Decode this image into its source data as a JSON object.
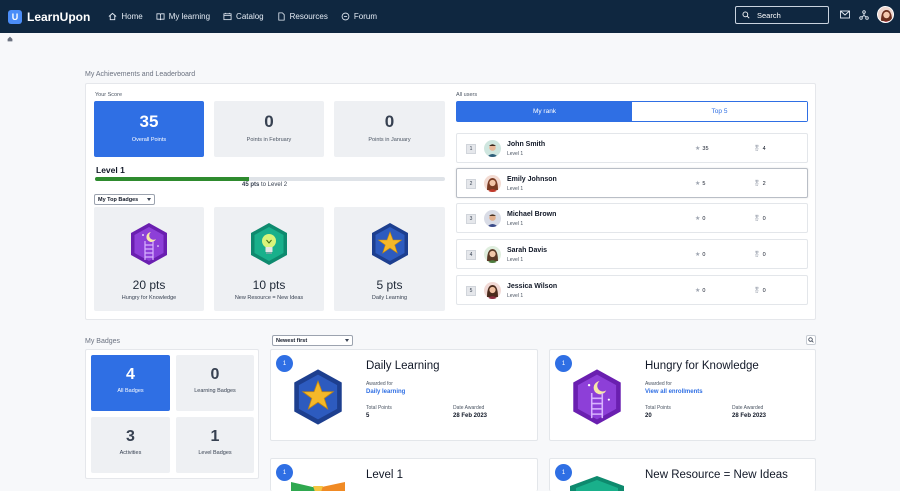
{
  "app": {
    "logo_text": "LearnUpon",
    "logo_letter": "U"
  },
  "nav": {
    "items": [
      {
        "label": "Home",
        "icon": "home-icon"
      },
      {
        "label": "My learning",
        "icon": "book-icon"
      },
      {
        "label": "Catalog",
        "icon": "catalog-icon"
      },
      {
        "label": "Resources",
        "icon": "file-icon"
      },
      {
        "label": "Forum",
        "icon": "chat-icon"
      }
    ],
    "search_placeholder": "Search"
  },
  "achievements": {
    "section_title": "My Achievements and Leaderboard",
    "your_score_label": "Your Score",
    "stats": [
      {
        "value": "35",
        "label": "Overall Points"
      },
      {
        "value": "0",
        "label": "Points in February"
      },
      {
        "value": "0",
        "label": "Points in January"
      }
    ],
    "level": "Level 1",
    "progress_fraction": 0.44,
    "pts_to_value": "45 pts",
    "pts_to_text": "to Level 2",
    "top_badges_dropdown": "My Top Badges",
    "top_badges": [
      {
        "pts": "20 pts",
        "name": "Hungry for Knowledge"
      },
      {
        "pts": "10 pts",
        "name": "New Resource = New Ideas"
      },
      {
        "pts": "5 pts",
        "name": "Daily Learning"
      }
    ]
  },
  "leaderboard": {
    "filter_label": "All users",
    "tabs": [
      "My rank",
      "Top 5"
    ],
    "rows": [
      {
        "rank": "1",
        "name": "John Smith",
        "level": "Level 1",
        "points": "35",
        "badges": "4"
      },
      {
        "rank": "2",
        "name": "Emily Johnson",
        "level": "Level 1",
        "points": "5",
        "badges": "2"
      },
      {
        "rank": "3",
        "name": "Michael Brown",
        "level": "Level 1",
        "points": "0",
        "badges": "0"
      },
      {
        "rank": "4",
        "name": "Sarah Davis",
        "level": "Level 1",
        "points": "0",
        "badges": "0"
      },
      {
        "rank": "5",
        "name": "Jessica Wilson",
        "level": "Level 1",
        "points": "0",
        "badges": "0"
      }
    ]
  },
  "badges": {
    "section_title": "My Badges",
    "sort_dropdown": "Newest first",
    "stats": [
      {
        "value": "4",
        "label": "All Badges"
      },
      {
        "value": "0",
        "label": "Learning Badges"
      },
      {
        "value": "3",
        "label": "Activities"
      },
      {
        "value": "1",
        "label": "Level Badges"
      }
    ],
    "cards": [
      {
        "count": "1",
        "title": "Daily Learning",
        "awarded_for_label": "Awarded for",
        "awarded_for": "Daily learning",
        "points_label": "Total Points",
        "points": "5",
        "date_label": "Date Awarded",
        "date": "28 Feb 2023"
      },
      {
        "count": "1",
        "title": "Hungry for Knowledge",
        "awarded_for_label": "Awarded for",
        "awarded_for": "View all enrollments",
        "points_label": "Total Points",
        "points": "20",
        "date_label": "Date Awarded",
        "date": "28 Feb 2023"
      },
      {
        "count": "1",
        "title": "Level 1"
      },
      {
        "count": "1",
        "title": "New Resource = New Ideas"
      }
    ]
  },
  "colors": {
    "nav_bg": "#0f2740",
    "primary": "#2f6fe4",
    "progress": "#2e8b2e"
  }
}
